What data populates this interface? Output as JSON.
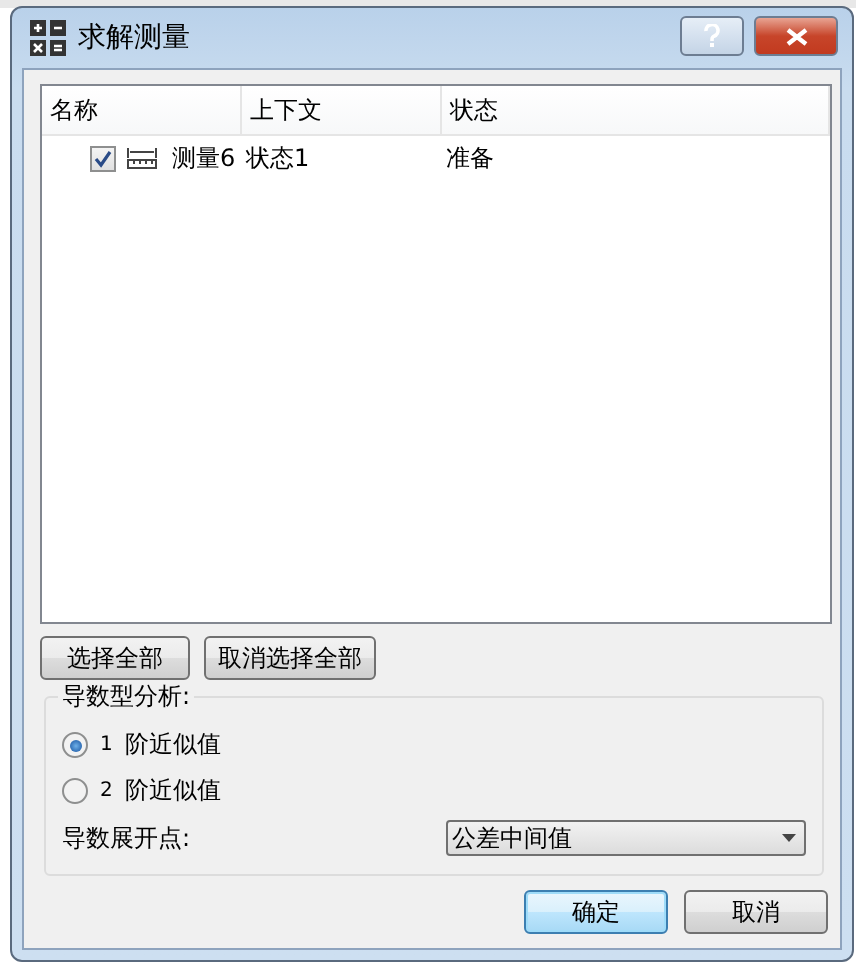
{
  "window": {
    "title": "求解测量"
  },
  "table": {
    "columns": [
      "名称",
      "上下文",
      "状态"
    ],
    "rows": [
      {
        "checked": true,
        "cells": [
          "测量6",
          "状态1",
          "准备"
        ]
      }
    ]
  },
  "list_buttons": [
    "选择全部",
    "取消选择全部"
  ],
  "analysis": {
    "title": "导数型分析:",
    "options": [
      {
        "number": "1",
        "label": "阶近似值",
        "selected": true
      },
      {
        "number": "2",
        "label": "阶近似值",
        "selected": false
      }
    ],
    "expansion_label": "导数展开点:",
    "expansion_value": "公差中间值"
  },
  "buttons": [
    {
      "label": "确定",
      "default": true
    },
    {
      "label": "取消",
      "default": false
    }
  ]
}
